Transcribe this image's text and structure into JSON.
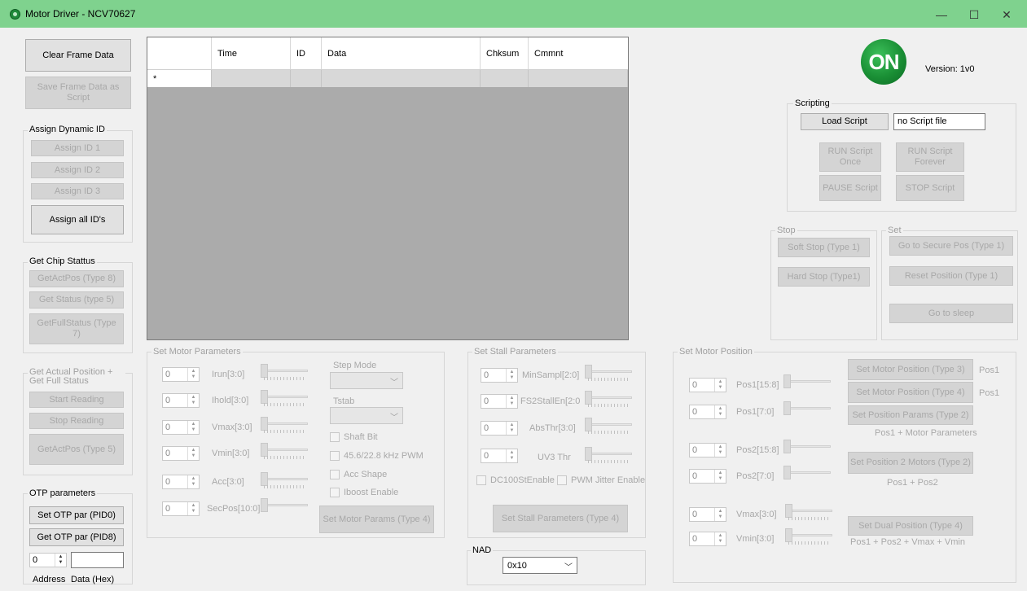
{
  "window": {
    "title": "Motor Driver - NCV70627",
    "minimize": "—",
    "maximize": "☐",
    "close": "✕"
  },
  "left": {
    "clear_frame": "Clear Frame Data",
    "save_frame": "Save Frame Data as Script",
    "assign_group": "Assign Dynamic ID",
    "assign_id1": "Assign ID 1",
    "assign_id2": "Assign ID 2",
    "assign_id3": "Assign ID 3",
    "assign_all": "Assign all ID's",
    "chip_group": "Get Chip Stattus",
    "get_act_pos8": "GetActPos (Type 8)",
    "get_status5": "Get Status  (type 5)",
    "get_full_status7": "GetFullStatus (Type 7)",
    "actual_group": "Get Actual Position + Get Full Status",
    "start_reading": "Start Reading",
    "stop_reading": "Stop Reading",
    "get_act_pos5": "GetActPos (Type 5)",
    "otp_group": "OTP parameters",
    "set_otp_pid0": "Set OTP par (PID0)",
    "get_otp_pid8": "Get OTP par (PID8)",
    "otp_address_value": "0",
    "otp_address_label": "Address",
    "otp_data_label": "Data (Hex)"
  },
  "grid": {
    "columns": [
      "",
      "Time",
      "ID",
      "Data",
      "Chksum",
      "Cmmnt"
    ],
    "new_row_marker": "*"
  },
  "header_right": {
    "logo_text": "ON",
    "version": "Version: 1v0"
  },
  "scripting": {
    "group": "Scripting",
    "load_script": "Load Script",
    "script_file": "no Script file",
    "run_once": "RUN Script Once",
    "run_forever": "RUN Script Forever",
    "pause": "PAUSE Script",
    "stop": "STOP Script"
  },
  "stop_group": {
    "label": "Stop",
    "soft_stop": "Soft Stop (Type 1)",
    "hard_stop": "Hard Stop (Type1)"
  },
  "set_group": {
    "label": "Set",
    "go_secure": "Go to Secure Pos (Type 1)",
    "reset_position": "Reset Position (Type 1)",
    "go_sleep": "Go to sleep"
  },
  "motor_params": {
    "group": "Set Motor Parameters",
    "irun": "Irun[3:0]",
    "ihold": "Ihold[3:0]",
    "vmax": "Vmax[3:0]",
    "vmin": "Vmin[3:0]",
    "acc": "Acc[3:0]",
    "secpos": "SecPos[10:0]",
    "spin_value": "0",
    "step_mode": "Step Mode",
    "tstab": "Tstab",
    "shaft_bit": "Shaft Bit",
    "pwm": "45.6/22.8 kHz PWM",
    "acc_shape": "Acc Shape",
    "iboost": "Iboost Enable",
    "set_button": "Set Motor Params (Type 4)"
  },
  "stall_params": {
    "group": "Set Stall Parameters",
    "minsampl": "MinSampl[2:0]",
    "fs2stallen": "FS2StallEn[2:0",
    "absthr": "AbsThr[3:0]",
    "uv3thr": "UV3 Thr",
    "spin_value": "0",
    "dc100": "DC100StEnable",
    "pwm_jitter": "PWM Jitter Enable",
    "set_button": "Set Stall Parameters (Type 4)"
  },
  "nad": {
    "label": "NAD",
    "value": "0x10"
  },
  "motor_position": {
    "group": "Set Motor Position",
    "pos1_hi": "Pos1[15:8]",
    "pos1_lo": "Pos1[7:0]",
    "pos2_hi": "Pos2[15:8]",
    "pos2_lo": "Pos2[7:0]",
    "vmax": "Vmax[3:0]",
    "vmin": "Vmin[3:0]",
    "spin_value": "0",
    "set_pos3": "Set Motor Position (Type 3)",
    "pos1_tag_a": "Pos1",
    "set_pos4": "Set Motor Position (Type 4)",
    "pos1_tag_b": "Pos1",
    "set_pos_params": "Set Position Params (Type 2)",
    "params_note": "Pos1 + Motor Parameters",
    "set_pos2_motors": "Set Position 2 Motors (Type 2)",
    "pos2_note": "Pos1 + Pos2",
    "set_dual": "Set Dual Position (Type 4)",
    "dual_note": "Pos1 + Pos2 + Vmax + Vmin"
  }
}
